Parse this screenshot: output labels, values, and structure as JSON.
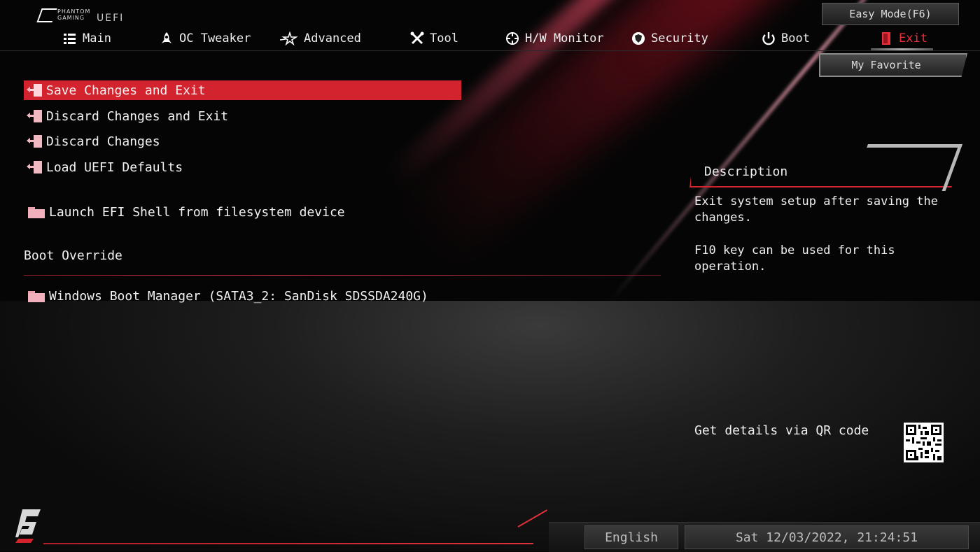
{
  "brand": {
    "logo_line1": "PHANTOM",
    "logo_line2": "GAMING",
    "logo_uefi": "UEFI"
  },
  "header": {
    "easy_mode_label": "Easy Mode(F6)",
    "tabs": [
      {
        "label": "Main",
        "icon": "list-icon"
      },
      {
        "label": "OC Tweaker",
        "icon": "rocket-icon"
      },
      {
        "label": "Advanced",
        "icon": "star-icon"
      },
      {
        "label": "Tool",
        "icon": "tools-icon"
      },
      {
        "label": "H/W Monitor",
        "icon": "crosshair-icon"
      },
      {
        "label": "Security",
        "icon": "shield-icon"
      },
      {
        "label": "Boot",
        "icon": "power-icon"
      },
      {
        "label": "Exit",
        "icon": "exit-door-icon",
        "active": true
      }
    ],
    "my_favorite_label": "My Favorite"
  },
  "menu": {
    "items": [
      {
        "label": "Save Changes and Exit",
        "icon": "exit-door-icon",
        "selected": true
      },
      {
        "label": "Discard Changes and Exit",
        "icon": "exit-door-icon"
      },
      {
        "label": "Discard Changes",
        "icon": "exit-door-icon"
      },
      {
        "label": "Load UEFI Defaults",
        "icon": "exit-door-icon"
      },
      {
        "label": "Launch EFI Shell from filesystem device",
        "icon": "folder-icon"
      }
    ],
    "boot_override_label": "Boot Override",
    "boot_devices": [
      {
        "label": "Windows Boot Manager (SATA3_2: SanDisk SDSSDA240G)",
        "icon": "folder-icon"
      }
    ]
  },
  "description": {
    "title": "Description",
    "line1": "Exit system setup after saving the changes.",
    "line2": "F10 key can be used for this operation."
  },
  "qr": {
    "label": "Get details via QR code"
  },
  "footer": {
    "language": "English",
    "datetime": "Sat 12/03/2022, 21:24:51"
  },
  "colors": {
    "accent": "#d2232e",
    "text": "#f0f0f0",
    "background": "#050505"
  }
}
